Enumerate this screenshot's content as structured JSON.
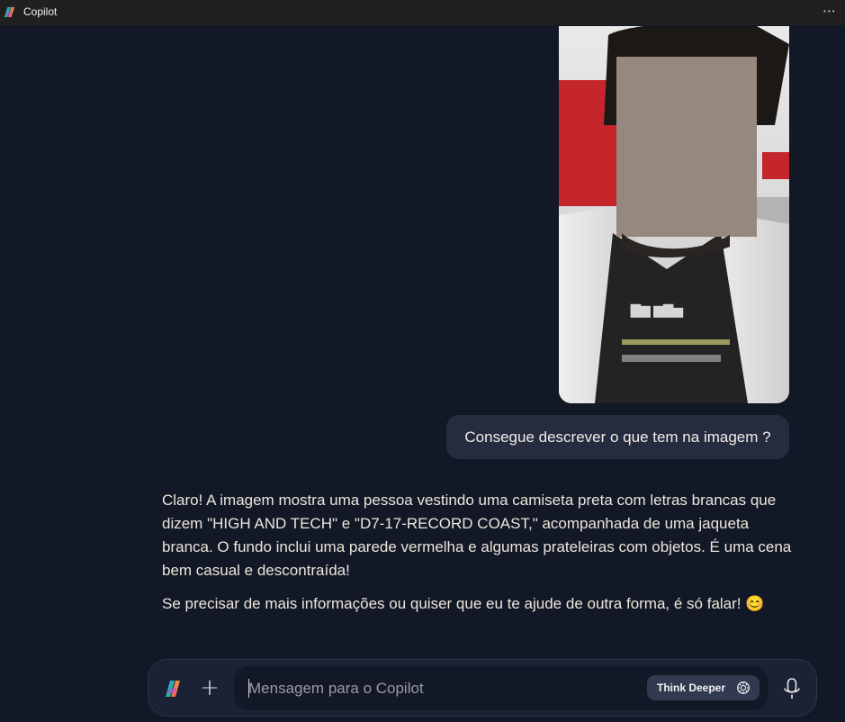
{
  "window": {
    "title": "Copilot",
    "more_label": "⋯"
  },
  "conversation": {
    "user_message": "Consegue descrever o que tem na imagem ?",
    "assistant_paragraphs": [
      "Claro! A imagem mostra uma pessoa vestindo uma camiseta preta com letras brancas que dizem \"HIGH AND TECH\" e \"D7-17-RECORD COAST,\" acompanhada de uma jaqueta branca. O fundo inclui uma parede vermelha e algumas prateleiras com objetos. É uma cena bem casual e descontraída!",
      "Se precisar de mais informações ou quiser que eu te ajude de outra forma, é só falar! 😊"
    ]
  },
  "composer": {
    "plus_label": "+",
    "placeholder": "Mensagem para o Copilot",
    "value": "",
    "think_deeper_label": "Think Deeper"
  },
  "icons": {
    "app": "copilot-logo-icon",
    "composer": "copilot-logo-icon",
    "think": "think-deeper-icon",
    "mic": "microphone-icon",
    "more": "more-options-icon"
  },
  "colors": {
    "background": "#121826",
    "titlebar": "#202020",
    "bubble": "#262c40",
    "composer": "#1b2235",
    "text": "#ece6dc"
  }
}
